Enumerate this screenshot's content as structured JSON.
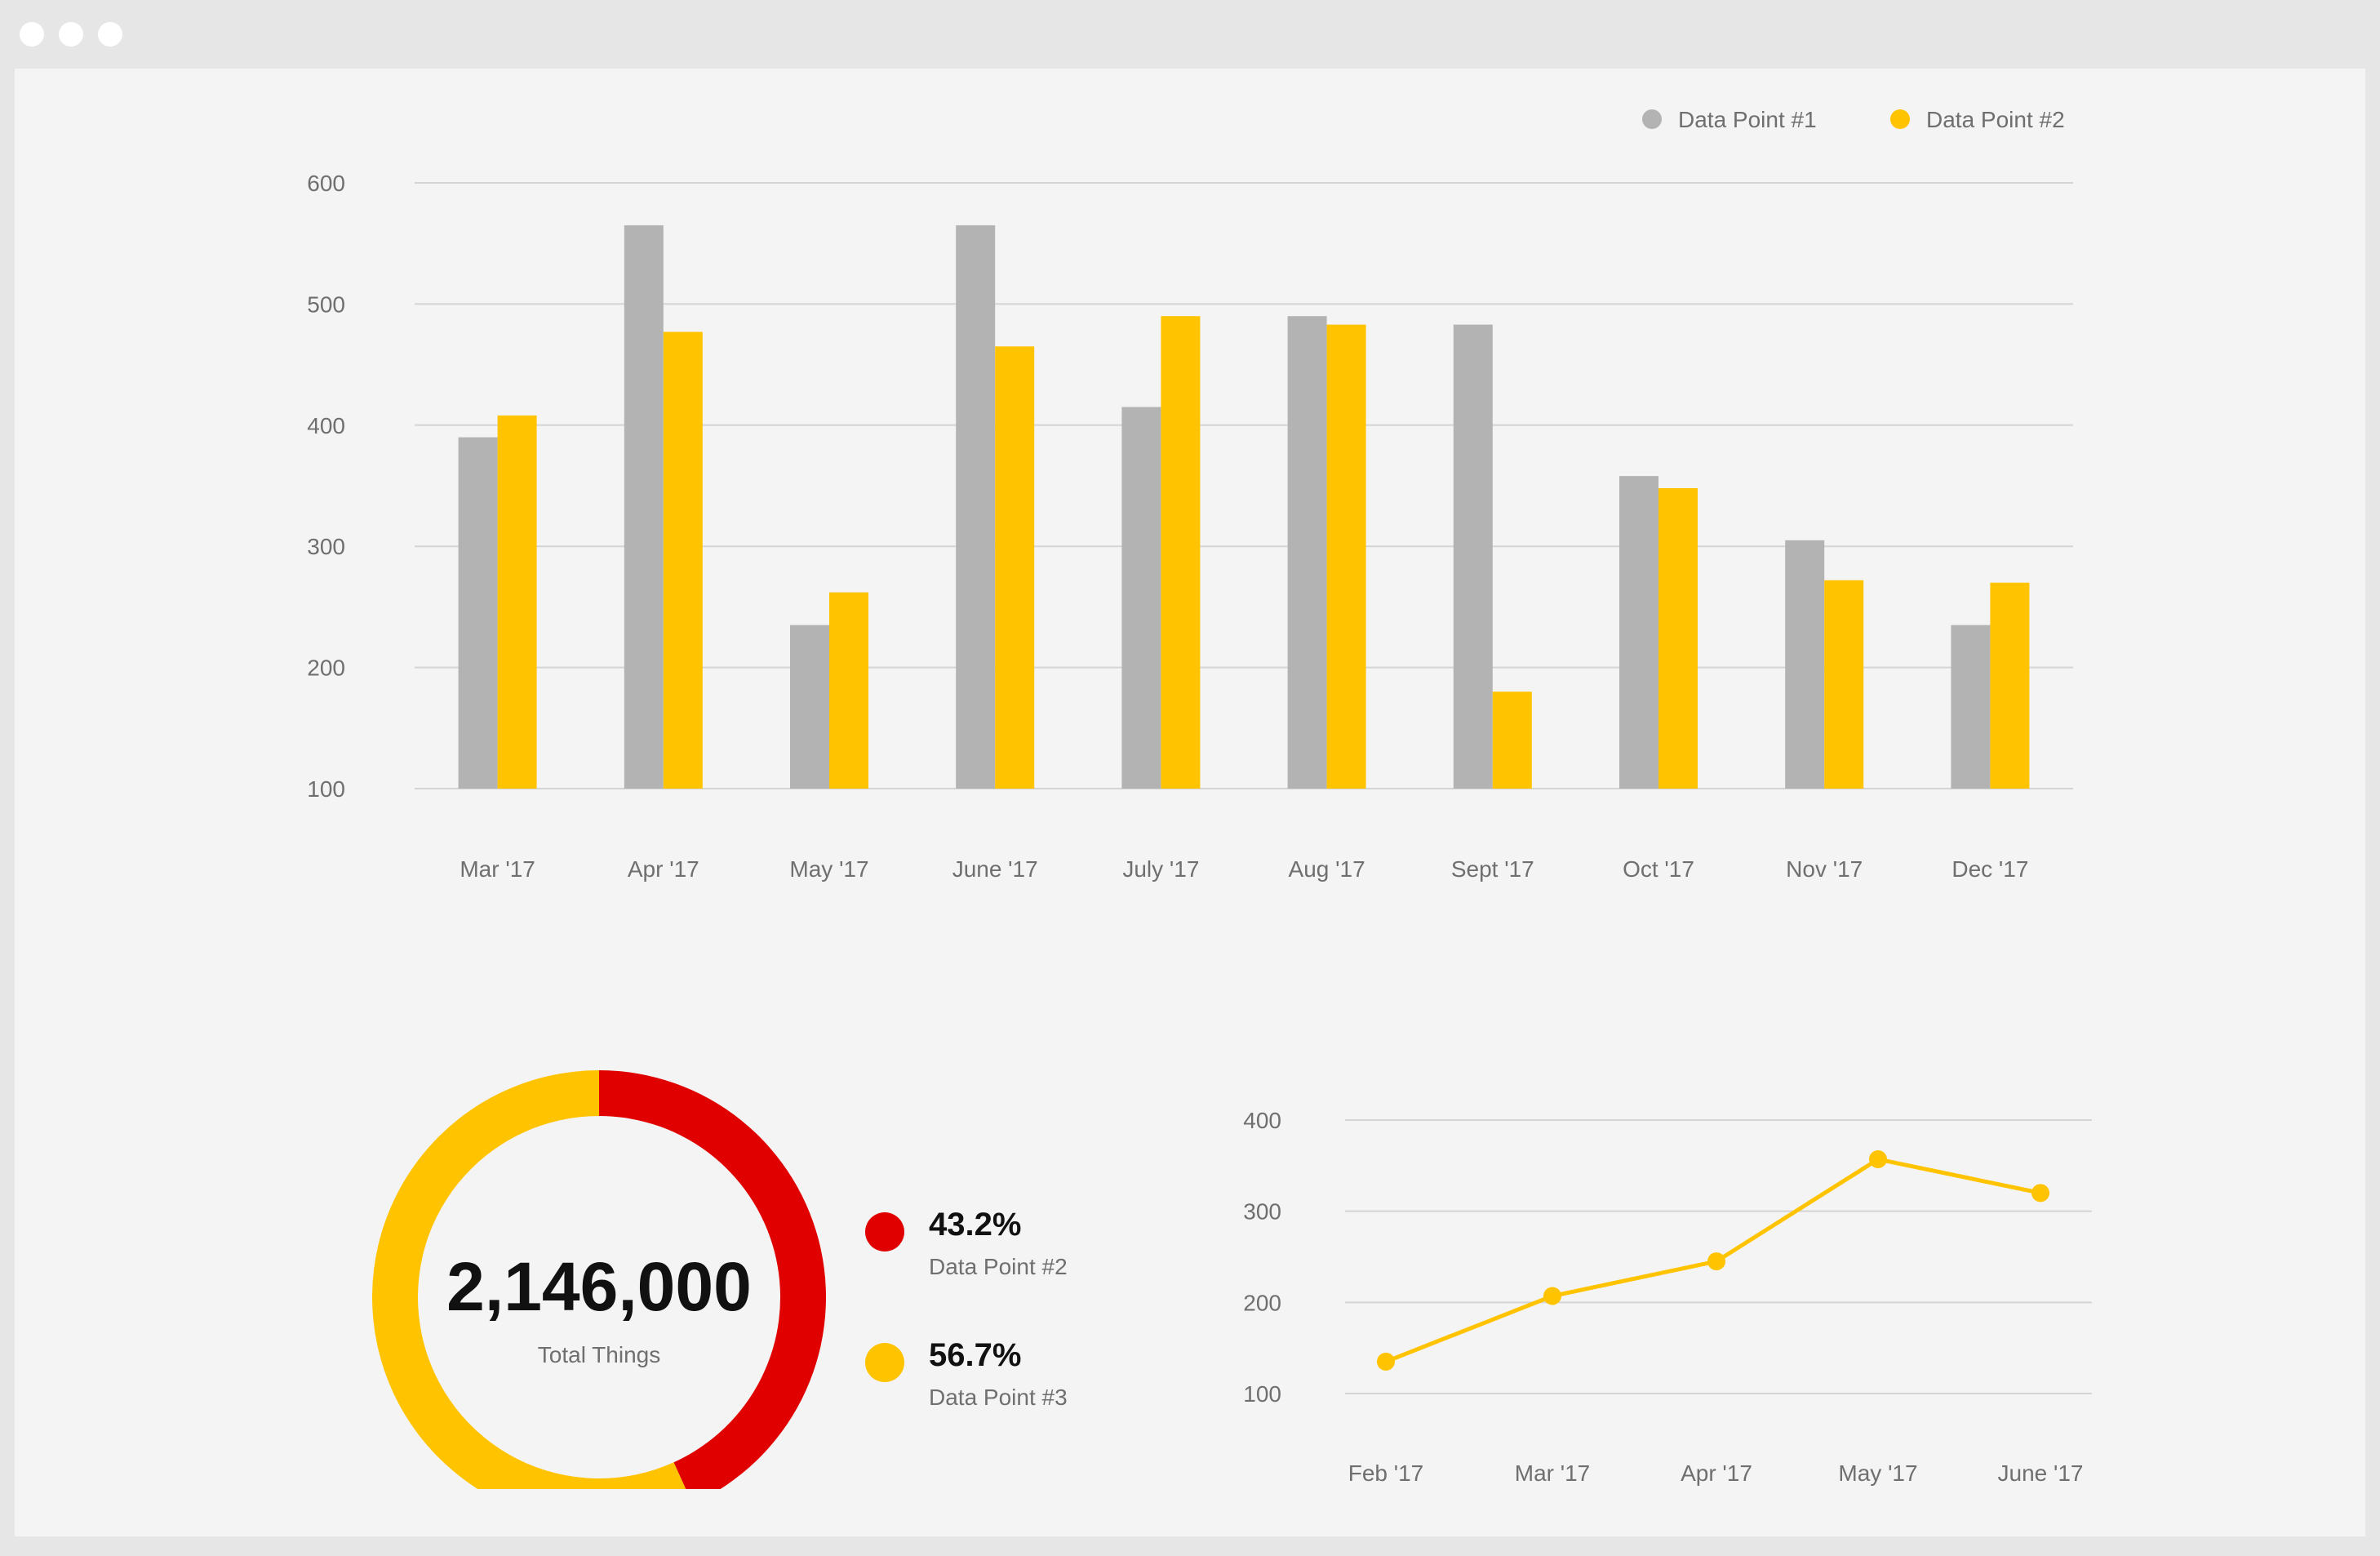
{
  "window": {
    "controls": [
      "close-dot",
      "minimize-dot",
      "maximize-dot"
    ]
  },
  "colors": {
    "series1": "#b3b3b3",
    "series2": "#ffc300",
    "donut_red": "#e00000",
    "grid": "#d4d4d4",
    "axis_text": "#6f6f6f"
  },
  "chart_data": [
    {
      "type": "bar",
      "categories": [
        "Mar '17",
        "Apr '17",
        "May '17",
        "June '17",
        "July '17",
        "Aug '17",
        "Sept '17",
        "Oct '17",
        "Nov '17",
        "Dec '17"
      ],
      "series": [
        {
          "name": "Data Point #1",
          "values": [
            390,
            565,
            235,
            565,
            415,
            490,
            483,
            358,
            305,
            235
          ]
        },
        {
          "name": "Data Point #2",
          "values": [
            408,
            477,
            262,
            465,
            490,
            483,
            180,
            348,
            272,
            270
          ]
        }
      ],
      "yticks": [
        100,
        200,
        300,
        400,
        500,
        600
      ],
      "ylim": [
        100,
        600
      ],
      "legend_position": "top-right",
      "grid": true
    },
    {
      "type": "pie",
      "variant": "donut",
      "center_value": "2,146,000",
      "center_label": "Total Things",
      "slices": [
        {
          "name": "Data Point #2",
          "value": 43.2,
          "label": "43.2%",
          "color": "#e00000"
        },
        {
          "name": "Data Point #3",
          "value": 56.7,
          "label": "56.7%",
          "color": "#ffc300"
        }
      ]
    },
    {
      "type": "line",
      "categories": [
        "Feb '17",
        "Mar '17",
        "Apr '17",
        "May '17",
        "June '17"
      ],
      "values": [
        135,
        207,
        245,
        357,
        320
      ],
      "yticks": [
        100,
        200,
        300,
        400
      ],
      "ylim": [
        100,
        400
      ],
      "grid": true,
      "color": "#ffc300"
    }
  ]
}
